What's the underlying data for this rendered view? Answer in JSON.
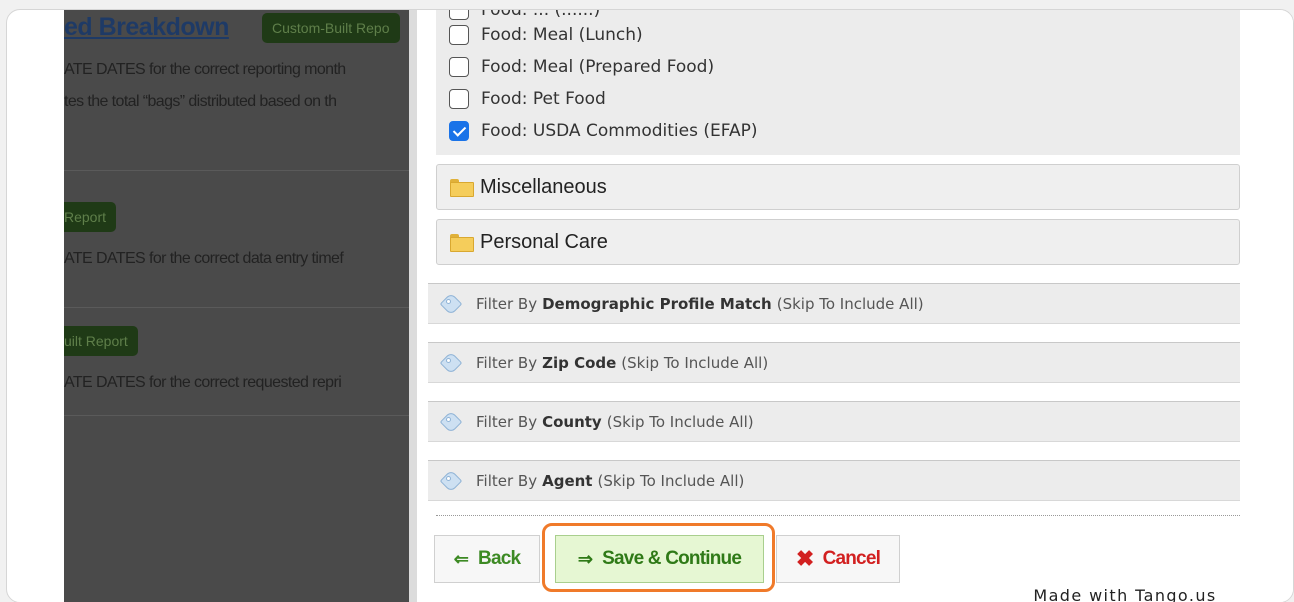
{
  "background": {
    "title": "ed Breakdown",
    "badges": [
      "Custom-Built Repo",
      "Report",
      "uilt Report"
    ],
    "texts": [
      "ATE DATES for the correct reporting month",
      "tes the total “bags” distributed based on th",
      "ATE DATES for the correct data entry timef",
      "ATE DATES for the correct requested repri"
    ]
  },
  "options": [
    {
      "label": "Food: Meal (Lunch)",
      "checked": false
    },
    {
      "label": "Food: Meal (Prepared Food)",
      "checked": false
    },
    {
      "label": "Food: Pet Food",
      "checked": false
    },
    {
      "label": "Food: USDA Commodities (EFAP)",
      "checked": true
    }
  ],
  "partial_option": "Food: ... (......)",
  "categories": [
    {
      "label": "Miscellaneous",
      "icon": "folder-icon"
    },
    {
      "label": "Personal Care",
      "icon": "folder-icon"
    }
  ],
  "filters": [
    {
      "prefix": "Filter By",
      "field": "Demographic Profile Match",
      "suffix": "(Skip To Include All)"
    },
    {
      "prefix": "Filter By",
      "field": "Zip Code",
      "suffix": "(Skip To Include All)"
    },
    {
      "prefix": "Filter By",
      "field": "County",
      "suffix": "(Skip To Include All)"
    },
    {
      "prefix": "Filter By",
      "field": "Agent",
      "suffix": "(Skip To Include All)"
    }
  ],
  "buttons": {
    "back": "Back",
    "save": "Save & Continue",
    "cancel": "Cancel",
    "back_arrow": "⇐",
    "save_arrow": "⇒",
    "cancel_x": "✖"
  },
  "watermark": "Made with Tango.us",
  "colors": {
    "accent_blue": "#1a73e8",
    "highlight_orange": "#f07a2a",
    "save_green": "#2f7a17",
    "cancel_red": "#d22020"
  }
}
